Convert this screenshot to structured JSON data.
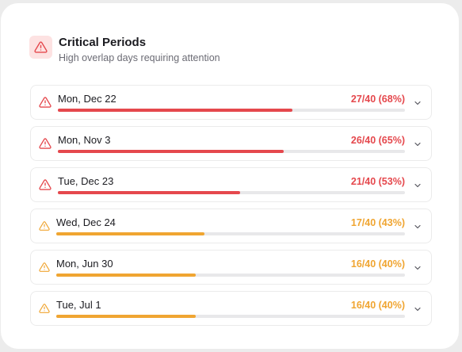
{
  "panel": {
    "title": "Critical Periods",
    "subtitle": "High overlap days requiring attention",
    "header_icon": "alert-triangle-icon"
  },
  "colors": {
    "critical": "#e5484d",
    "warning": "#f0a531",
    "track": "#e8e8ea"
  },
  "periods": [
    {
      "date": "Mon, Dec 22",
      "value_label": "27/40 (68%)",
      "fraction": 0.675,
      "severity": "critical"
    },
    {
      "date": "Mon, Nov 3",
      "value_label": "26/40 (65%)",
      "fraction": 0.65,
      "severity": "critical"
    },
    {
      "date": "Tue, Dec 23",
      "value_label": "21/40 (53%)",
      "fraction": 0.525,
      "severity": "critical"
    },
    {
      "date": "Wed, Dec 24",
      "value_label": "17/40 (43%)",
      "fraction": 0.425,
      "severity": "warning"
    },
    {
      "date": "Mon, Jun 30",
      "value_label": "16/40 (40%)",
      "fraction": 0.4,
      "severity": "warning"
    },
    {
      "date": "Tue, Jul 1",
      "value_label": "16/40 (40%)",
      "fraction": 0.4,
      "severity": "warning"
    }
  ]
}
